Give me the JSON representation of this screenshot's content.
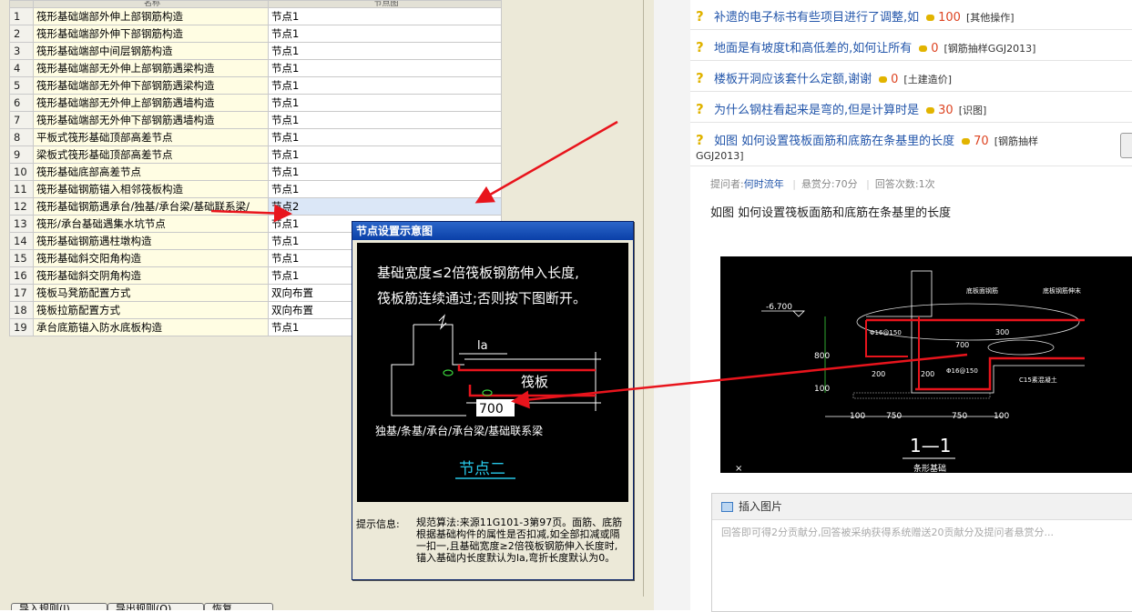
{
  "grid": {
    "header": "名称",
    "header_value": "节点图",
    "rows": [
      {
        "n": "1",
        "name": "筏形基础端部外伸上部钢筋构造",
        "value": "节点1"
      },
      {
        "n": "2",
        "name": "筏形基础端部外伸下部钢筋构造",
        "value": "节点1"
      },
      {
        "n": "3",
        "name": "筏形基础端部中间层钢筋构造",
        "value": "节点1"
      },
      {
        "n": "4",
        "name": "筏形基础端部无外伸上部钢筋遇梁构造",
        "value": "节点1"
      },
      {
        "n": "5",
        "name": "筏形基础端部无外伸下部钢筋遇梁构造",
        "value": "节点1"
      },
      {
        "n": "6",
        "name": "筏形基础端部无外伸上部钢筋遇墙构造",
        "value": "节点1"
      },
      {
        "n": "7",
        "name": "筏形基础端部无外伸下部钢筋遇墙构造",
        "value": "节点1"
      },
      {
        "n": "8",
        "name": "平板式筏形基础顶部高差节点",
        "value": "节点1"
      },
      {
        "n": "9",
        "name": "梁板式筏形基础顶部高差节点",
        "value": "节点1"
      },
      {
        "n": "10",
        "name": "筏形基础底部高差节点",
        "value": "节点1"
      },
      {
        "n": "11",
        "name": "筏形基础钢筋锚入相邻筏板构造",
        "value": "节点1"
      },
      {
        "n": "12",
        "name": "筏形基础钢筋遇承台/独基/承台梁/基础联系梁/",
        "value": "节点2"
      },
      {
        "n": "13",
        "name": "筏形/承台基础遇集水坑节点",
        "value": "节点1"
      },
      {
        "n": "14",
        "name": "筏形基础钢筋遇柱墩构造",
        "value": "节点1"
      },
      {
        "n": "15",
        "name": "筏形基础斜交阳角构造",
        "value": "节点1"
      },
      {
        "n": "16",
        "name": "筏形基础斜交阴角构造",
        "value": "节点1"
      },
      {
        "n": "17",
        "name": "筏板马凳筋配置方式",
        "value": "双向布置"
      },
      {
        "n": "18",
        "name": "筏板拉筋配置方式",
        "value": "双向布置"
      },
      {
        "n": "19",
        "name": "承台底筋锚入防水底板构造",
        "value": "节点1"
      }
    ]
  },
  "bottom_buttons": [
    "导入规则(I)",
    "导出规则(O)",
    "恢复"
  ],
  "popup": {
    "title": "节点设置示意图",
    "diagram_line1": "基础宽度≤2倍筏板钢筋伸入长度,",
    "diagram_line2": "筏板筋连续通过;否则按下图断开。",
    "label_la": "la",
    "label_raft": "筏板",
    "label_700": "700",
    "label_types": "独基/条基/承台/承台梁/基础联系梁",
    "node_name": "节点二",
    "info_label": "提示信息:",
    "info_text": "规范算法:来源11G101-3第97页。面筋、底筋根据基础构件的属性是否扣减,如全部扣减或隔一扣一,且基础宽度≥2倍筏板钢筋伸入长度时,锚入基础内长度默认为la,弯折长度默认为0。"
  },
  "questions": [
    {
      "title": "补遗的电子标书有些项目进行了调整,如",
      "reward": "100",
      "tag": "[其他操作]"
    },
    {
      "title": "地面是有坡度t和高低差的,如何让所有",
      "reward": "0",
      "tag": "[钢筋抽样GGJ2013]"
    },
    {
      "title": "楼板开洞应该套什么定额,谢谢",
      "reward": "0",
      "tag": "[土建造价]"
    },
    {
      "title": "为什么钢柱看起来是弯的,但是计算时是",
      "reward": "30",
      "tag": "[识图]"
    },
    {
      "title": "如图 如何设置筏板面筋和底筋在条基里的长度",
      "reward": "70",
      "tag": "[钢筋抽样",
      "tag2": "GGJ2013]"
    }
  ],
  "meta": {
    "asker_label": "提问者:",
    "asker": "何时流年",
    "bounty": "悬赏分:70分",
    "answers": "回答次数:1次"
  },
  "question_title": "如图 如何设置筏板面筋和底筋在条基里的长度",
  "drawing": {
    "elev": "-6.700",
    "dim_800": "800",
    "dim_100": "100",
    "label_bottom_rebar": "底板面钢筋",
    "label_rebar_ext": "底板钢筋伸末",
    "label_700": "700",
    "label_300": "300",
    "label_phi1": "Φ16@150",
    "label_phi2": "Φ16@150",
    "label_200a": "200",
    "label_200b": "200",
    "label_c15": "C15素混凝土",
    "dim_a": "100",
    "dim_b": "750",
    "dim_c": "750",
    "dim_d": "100",
    "section": "1—1",
    "caption": "条形基础"
  },
  "insert": {
    "label": "插入图片",
    "placeholder": "回答即可得2分贡献分,回答被采纳获得系统赠送20贡献分及提问者悬赏分..."
  },
  "colors": {
    "arrow": "#e8141c",
    "rebar": "#e8141c",
    "link": "#2255aa",
    "reward": "#dd4422"
  }
}
